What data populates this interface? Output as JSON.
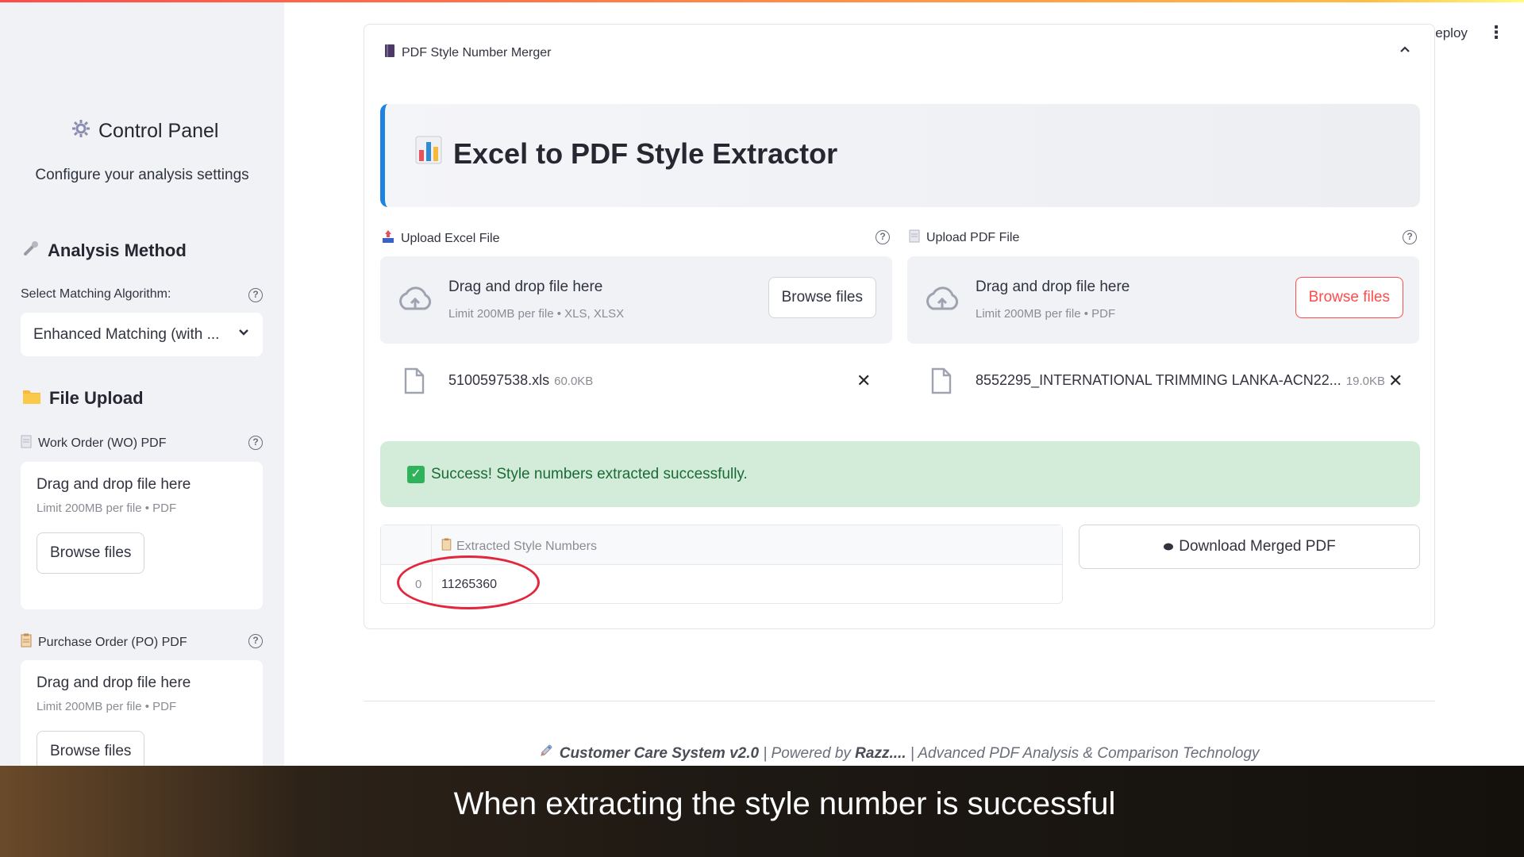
{
  "sidebar": {
    "title": "Control Panel",
    "subtitle": "Configure your analysis settings",
    "analysis_heading": "Analysis Method",
    "select_label": "Select Matching Algorithm:",
    "select_value": "Enhanced Matching (with ...",
    "upload_heading": "File Upload",
    "wo_label": "Work Order (WO) PDF",
    "po_label": "Purchase Order (PO) PDF",
    "drop_text": "Drag and drop file here",
    "drop_limit": "Limit 200MB per file • PDF",
    "browse": "Browse files"
  },
  "main": {
    "expander_title": "PDF Style Number Merger",
    "hero_title": "Excel to PDF Style Extractor",
    "excel": {
      "label": "Upload Excel File",
      "drop_text": "Drag and drop file here",
      "limit": "Limit 200MB per file • XLS, XLSX",
      "browse": "Browse files",
      "file_name": "5100597538.xls",
      "file_size": "60.0KB"
    },
    "pdf": {
      "label": "Upload PDF File",
      "drop_text": "Drag and drop file here",
      "limit": "Limit 200MB per file • PDF",
      "browse": "Browse files",
      "file_name": "8552295_INTERNATIONAL TRIMMING LANKA-ACN22...",
      "file_size": "19.0KB"
    },
    "success": "Success! Style numbers extracted successfully.",
    "table": {
      "column": "Extracted Style Numbers",
      "rows": [
        {
          "index": "0",
          "value": "11265360"
        }
      ]
    },
    "download": "Download Merged PDF"
  },
  "footer": {
    "system": "Customer Care System v2.0",
    "sep1": " | Powered by ",
    "brand": "Razz....",
    "tagline": " | Advanced PDF Analysis & Comparison Technology"
  },
  "header": {
    "deploy": "Deploy"
  },
  "caption": "When extracting the style number is successful",
  "colors": {
    "accent": "#ff4b4b",
    "info_border": "#1c83e1",
    "success_bg": "#d3ecda",
    "annotation": "#e2263c"
  }
}
